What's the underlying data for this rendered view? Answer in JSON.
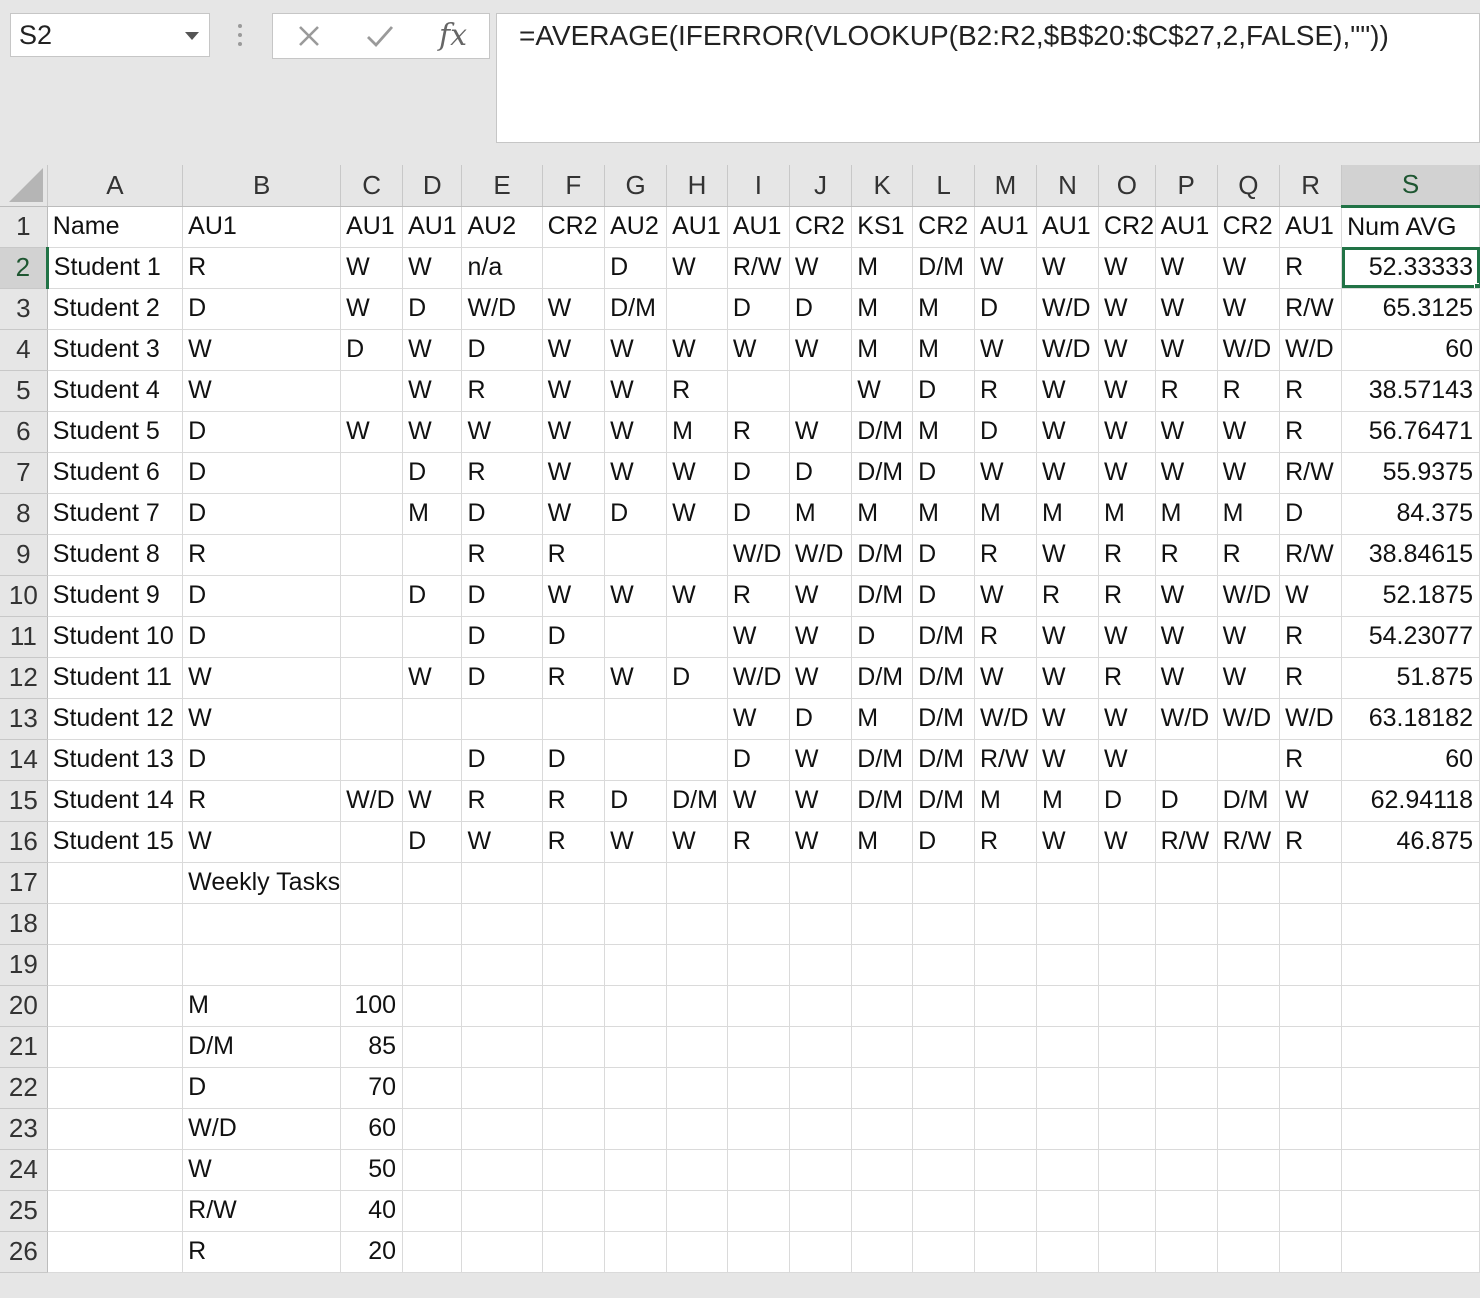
{
  "name_box": {
    "value": "S2"
  },
  "formula_bar": {
    "fx_label": "fx",
    "formula": "=AVERAGE(IFERROR(VLOOKUP(B2:R2,$B$20:$C$27,2,FALSE),\"\"))"
  },
  "columns": [
    "A",
    "B",
    "C",
    "D",
    "E",
    "F",
    "G",
    "H",
    "I",
    "J",
    "K",
    "L",
    "M",
    "N",
    "O",
    "P",
    "Q",
    "R",
    "S"
  ],
  "selected_column": "S",
  "selected_row": "2",
  "rows": [
    {
      "n": "1",
      "cells": [
        "Name",
        "AU1",
        "AU1",
        "AU1",
        "AU2",
        "CR2",
        "AU2",
        "AU1",
        "AU1",
        "CR2",
        "KS1",
        "CR2",
        "AU1",
        "AU1",
        "CR2",
        "AU1",
        "CR2",
        "AU1",
        "Num AVG"
      ]
    },
    {
      "n": "2",
      "cells": [
        "Student 1",
        "R",
        "W",
        "W",
        "n/a",
        "",
        "D",
        "W",
        "R/W",
        "W",
        "M",
        "D/M",
        "W",
        "W",
        "W",
        "W",
        "W",
        "R",
        "52.33333"
      ]
    },
    {
      "n": "3",
      "cells": [
        "Student 2",
        "D",
        "W",
        "D",
        "W/D",
        "W",
        "D/M",
        "",
        "D",
        "D",
        "M",
        "M",
        "D",
        "W/D",
        "W",
        "W",
        "W",
        "R/W",
        "65.3125"
      ]
    },
    {
      "n": "4",
      "cells": [
        "Student 3",
        "W",
        "D",
        "W",
        "D",
        "W",
        "W",
        "W",
        "W",
        "W",
        "M",
        "M",
        "W",
        "W/D",
        "W",
        "W",
        "W/D",
        "W/D",
        "60"
      ]
    },
    {
      "n": "5",
      "cells": [
        "Student 4",
        "W",
        "",
        "W",
        "R",
        "W",
        "W",
        "R",
        "",
        "",
        "W",
        "D",
        "R",
        "W",
        "W",
        "R",
        "R",
        "R",
        "38.57143"
      ]
    },
    {
      "n": "6",
      "cells": [
        "Student 5",
        "D",
        "W",
        "W",
        "W",
        "W",
        "W",
        "M",
        "R",
        "W",
        "D/M",
        "M",
        "D",
        "W",
        "W",
        "W",
        "W",
        "R",
        "56.76471"
      ]
    },
    {
      "n": "7",
      "cells": [
        "Student 6",
        "D",
        "",
        "D",
        "R",
        "W",
        "W",
        "W",
        "D",
        "D",
        "D/M",
        "D",
        "W",
        "W",
        "W",
        "W",
        "W",
        "R/W",
        "55.9375"
      ]
    },
    {
      "n": "8",
      "cells": [
        "Student 7",
        "D",
        "",
        "M",
        "D",
        "W",
        "D",
        "W",
        "D",
        "M",
        "M",
        "M",
        "M",
        "M",
        "M",
        "M",
        "M",
        "D",
        "84.375"
      ]
    },
    {
      "n": "9",
      "cells": [
        "Student 8",
        "R",
        "",
        "",
        "R",
        "R",
        "",
        "",
        "W/D",
        "W/D",
        "D/M",
        "D",
        "R",
        "W",
        "R",
        "R",
        "R",
        "R/W",
        "38.84615"
      ]
    },
    {
      "n": "10",
      "cells": [
        "Student 9",
        "D",
        "",
        "D",
        "D",
        "W",
        "W",
        "W",
        "R",
        "W",
        "D/M",
        "D",
        "W",
        "R",
        "R",
        "W",
        "W/D",
        "W",
        "52.1875"
      ]
    },
    {
      "n": "11",
      "cells": [
        "Student 10",
        "D",
        "",
        "",
        "D",
        "D",
        "",
        "",
        "W",
        "W",
        "D",
        "D/M",
        "R",
        "W",
        "W",
        "W",
        "W",
        "R",
        "54.23077"
      ]
    },
    {
      "n": "12",
      "cells": [
        "Student 11",
        "W",
        "",
        "W",
        "D",
        "R",
        "W",
        "D",
        "W/D",
        "W",
        "D/M",
        "D/M",
        "W",
        "W",
        "R",
        "W",
        "W",
        "R",
        "51.875"
      ]
    },
    {
      "n": "13",
      "cells": [
        "Student 12",
        "W",
        "",
        "",
        "",
        "",
        "",
        "",
        "W",
        "D",
        "M",
        "D/M",
        "W/D",
        "W",
        "W",
        "W/D",
        "W/D",
        "W/D",
        "63.18182"
      ]
    },
    {
      "n": "14",
      "cells": [
        "Student 13",
        "D",
        "",
        "",
        "D",
        "D",
        "",
        "",
        "D",
        "W",
        "D/M",
        "D/M",
        "R/W",
        "W",
        "W",
        "",
        "",
        "R",
        "60"
      ]
    },
    {
      "n": "15",
      "cells": [
        "Student 14",
        "R",
        "W/D",
        "W",
        "R",
        "R",
        "D",
        "D/M",
        "W",
        "W",
        "D/M",
        "D/M",
        "M",
        "M",
        "D",
        "D",
        "D/M",
        "W",
        "62.94118"
      ]
    },
    {
      "n": "16",
      "cells": [
        "Student 15",
        "W",
        "",
        "D",
        "W",
        "R",
        "W",
        "W",
        "R",
        "W",
        "M",
        "D",
        "R",
        "W",
        "W",
        "R/W",
        "R/W",
        "R",
        "46.875"
      ]
    },
    {
      "n": "17",
      "cells": [
        "",
        "Weekly Tasks",
        "",
        "",
        "",
        "",
        "",
        "",
        "",
        "",
        "",
        "",
        "",
        "",
        "",
        "",
        "",
        "",
        ""
      ]
    },
    {
      "n": "18",
      "cells": [
        "",
        "",
        "",
        "",
        "",
        "",
        "",
        "",
        "",
        "",
        "",
        "",
        "",
        "",
        "",
        "",
        "",
        "",
        ""
      ]
    },
    {
      "n": "19",
      "cells": [
        "",
        "",
        "",
        "",
        "",
        "",
        "",
        "",
        "",
        "",
        "",
        "",
        "",
        "",
        "",
        "",
        "",
        "",
        ""
      ]
    },
    {
      "n": "20",
      "cells": [
        "",
        "M",
        "100",
        "",
        "",
        "",
        "",
        "",
        "",
        "",
        "",
        "",
        "",
        "",
        "",
        "",
        "",
        "",
        ""
      ]
    },
    {
      "n": "21",
      "cells": [
        "",
        "D/M",
        "85",
        "",
        "",
        "",
        "",
        "",
        "",
        "",
        "",
        "",
        "",
        "",
        "",
        "",
        "",
        "",
        ""
      ]
    },
    {
      "n": "22",
      "cells": [
        "",
        "D",
        "70",
        "",
        "",
        "",
        "",
        "",
        "",
        "",
        "",
        "",
        "",
        "",
        "",
        "",
        "",
        "",
        ""
      ]
    },
    {
      "n": "23",
      "cells": [
        "",
        "W/D",
        "60",
        "",
        "",
        "",
        "",
        "",
        "",
        "",
        "",
        "",
        "",
        "",
        "",
        "",
        "",
        "",
        ""
      ]
    },
    {
      "n": "24",
      "cells": [
        "",
        "W",
        "50",
        "",
        "",
        "",
        "",
        "",
        "",
        "",
        "",
        "",
        "",
        "",
        "",
        "",
        "",
        "",
        ""
      ]
    },
    {
      "n": "25",
      "cells": [
        "",
        "R/W",
        "40",
        "",
        "",
        "",
        "",
        "",
        "",
        "",
        "",
        "",
        "",
        "",
        "",
        "",
        "",
        "",
        ""
      ]
    },
    {
      "n": "26",
      "cells": [
        "",
        "R",
        "20",
        "",
        "",
        "",
        "",
        "",
        "",
        "",
        "",
        "",
        "",
        "",
        "",
        "",
        "",
        "",
        ""
      ]
    }
  ],
  "colors": {
    "selection_green": "#217346",
    "header_bg": "#e6e6e6",
    "gridline": "#dadada"
  }
}
